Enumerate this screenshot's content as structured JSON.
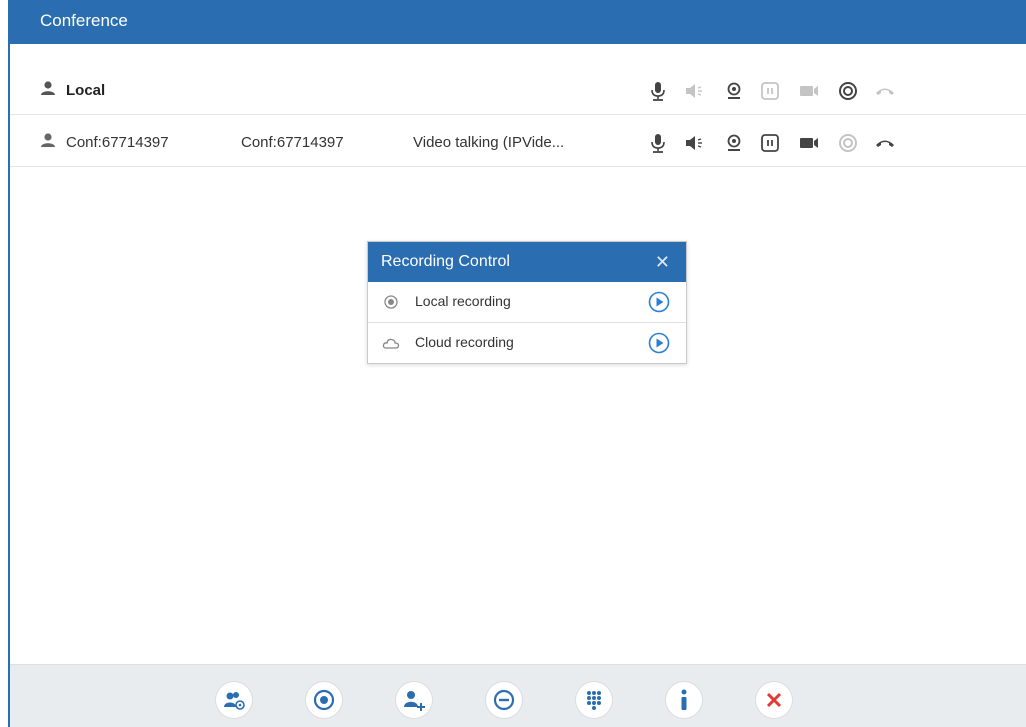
{
  "window": {
    "title": "Conference"
  },
  "participants": [
    {
      "name": "Local",
      "number": "",
      "status": ""
    },
    {
      "name": "Conf:67714397",
      "number": "Conf:67714397",
      "status": "Video talking (IPVide..."
    }
  ],
  "recording_dialog": {
    "title": "Recording Control",
    "close_glyph": "✕",
    "options": [
      {
        "label": "Local recording",
        "icon": "record-dot-icon"
      },
      {
        "label": "Cloud recording",
        "icon": "cloud-icon"
      }
    ]
  },
  "toolbar": {
    "buttons": [
      "manage-members-icon",
      "record-icon",
      "add-member-icon",
      "remove-member-icon",
      "dialpad-icon",
      "info-icon",
      "end-conference-icon"
    ]
  },
  "colors": {
    "accent": "#2a6db0",
    "danger": "#e53935",
    "footer_bg": "#e9ecef"
  }
}
